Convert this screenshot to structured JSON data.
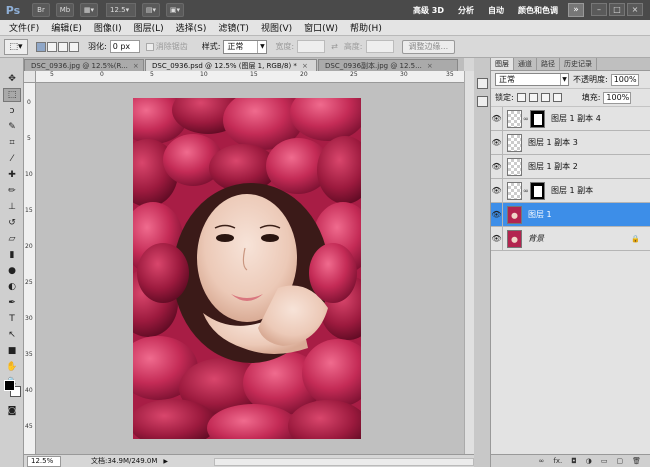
{
  "app": {
    "logo": "Ps",
    "bar_buttons": [
      "Br",
      "Mb"
    ],
    "zoom_level": "12.5",
    "workspaces": [
      "高级 3D",
      "分析",
      "自动",
      "颜色和色调"
    ],
    "more": "»",
    "window_controls": [
      "–",
      "□",
      "×"
    ]
  },
  "menu": [
    "文件(F)",
    "编辑(E)",
    "图像(I)",
    "图层(L)",
    "选择(S)",
    "滤镜(T)",
    "视图(V)",
    "窗口(W)",
    "帮助(H)"
  ],
  "options": {
    "feather_label": "羽化:",
    "feather_value": "0 px",
    "antialias_label": "消除锯齿",
    "style_label": "样式:",
    "style_value": "正常",
    "width_label": "宽度:",
    "height_label": "高度:",
    "refine_button": "调整边缘..."
  },
  "tabs": [
    {
      "label": "DSC_0936.jpg @ 12.5%(R...",
      "close": "×"
    },
    {
      "label": "DSC_0936.psd @ 12.5% (图层 1, RGB/8) *",
      "close": "×"
    },
    {
      "label": "DSC_0936副本.jpg @ 12.5...",
      "close": "×"
    }
  ],
  "rulers": {
    "h": [
      "5",
      "0",
      "5",
      "10",
      "15",
      "20",
      "25",
      "30",
      "35"
    ],
    "v": [
      "0",
      "5",
      "10",
      "15",
      "20",
      "25",
      "30",
      "35",
      "40",
      "45"
    ]
  },
  "status": {
    "zoom": "12.5%",
    "doc": "文档:34.9M/249.0M"
  },
  "layers_panel": {
    "tabs": [
      "图层",
      "通道",
      "路径",
      "历史记录"
    ],
    "blend_mode": "正常",
    "opacity_label": "不透明度:",
    "opacity_value": "100%",
    "lock_label": "锁定:",
    "fill_label": "填充:",
    "fill_value": "100%",
    "layers": [
      {
        "name": "图层 1 副本 4",
        "has_mask": true,
        "selected": false
      },
      {
        "name": "图层 1 副本 3",
        "has_mask": false,
        "selected": false
      },
      {
        "name": "图层 1 副本 2",
        "has_mask": false,
        "selected": false
      },
      {
        "name": "图层 1 副本",
        "has_mask": true,
        "selected": false
      },
      {
        "name": "图层 1",
        "has_mask": false,
        "selected": true
      },
      {
        "name": "背景",
        "has_mask": false,
        "selected": false,
        "locked": true
      }
    ],
    "footer_icons": [
      "link-icon",
      "fx-icon",
      "mask-icon",
      "adjustment-icon",
      "folder-icon",
      "new-layer-icon",
      "trash-icon"
    ],
    "footer_fx": "fx."
  },
  "colors": {
    "accent_selected": "#3d8ee8",
    "rose": "#c42b56",
    "canvas_bg": "#c0c0c0"
  }
}
